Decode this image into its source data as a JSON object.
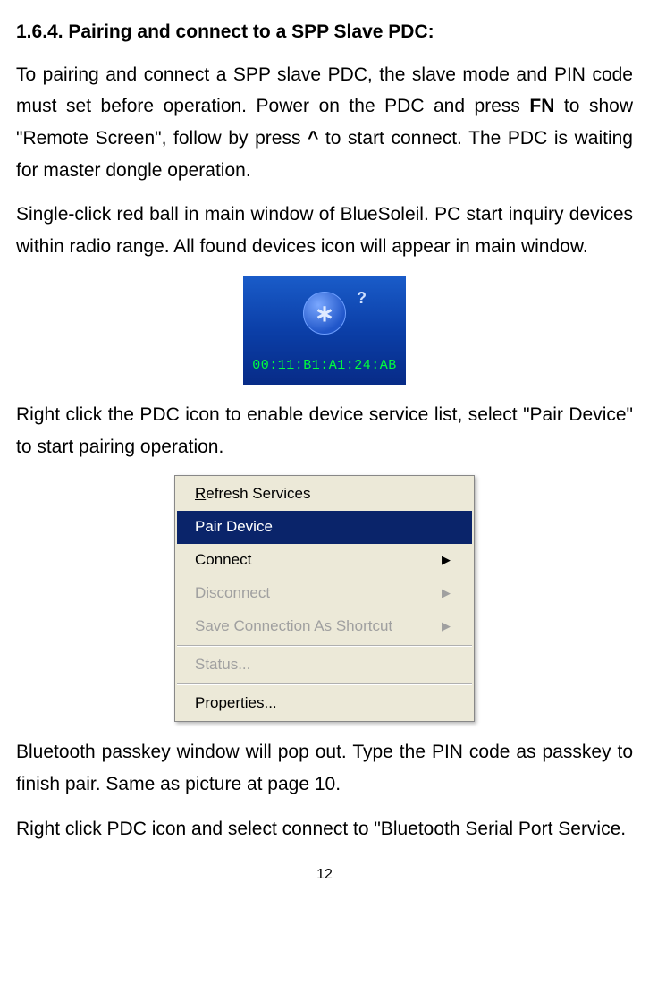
{
  "heading": "1.6.4. Pairing and connect to a SPP Slave PDC:",
  "para1_a": "To pairing and connect a SPP slave PDC, the slave mode and PIN code must set before operation. Power on the PDC and press ",
  "para1_fn": "FN",
  "para1_b": " to show \"Remote Screen\", follow by press ",
  "para1_caret": "^",
  "para1_c": " to start connect. The PDC is waiting for master dongle operation.",
  "para2": "Single-click red ball in main window of BlueSoleil. PC start inquiry devices within radio range. All found devices icon will appear in main window.",
  "bt_mac": "00:11:B1:A1:24:AB",
  "para3": "Right click the PDC icon to enable device service list, select \"Pair Device\" to start pairing operation.",
  "menu": {
    "refresh": "Refresh Services",
    "pair": "Pair Device",
    "connect": "Connect",
    "disconnect": "Disconnect",
    "shortcut": "Save Connection As Shortcut",
    "status": "Status...",
    "properties": "Properties..."
  },
  "para4": "Bluetooth passkey window will pop out. Type the PIN code as passkey to finish pair. Same as picture at page 10.",
  "para5": "Right click PDC icon and select connect to \"Bluetooth Serial Port Service.",
  "page_number": "12"
}
